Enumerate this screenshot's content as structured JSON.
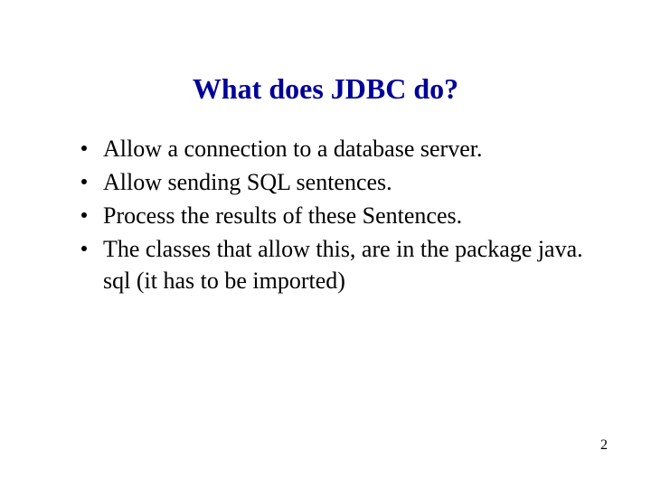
{
  "title": "What does JDBC do?",
  "bullets": [
    "Allow a connection to a database server.",
    "Allow sending SQL sentences.",
    "Process the results of these Sentences.",
    "The classes that allow this, are in the package java. sql (it has to be imported)"
  ],
  "pageNumber": "2"
}
